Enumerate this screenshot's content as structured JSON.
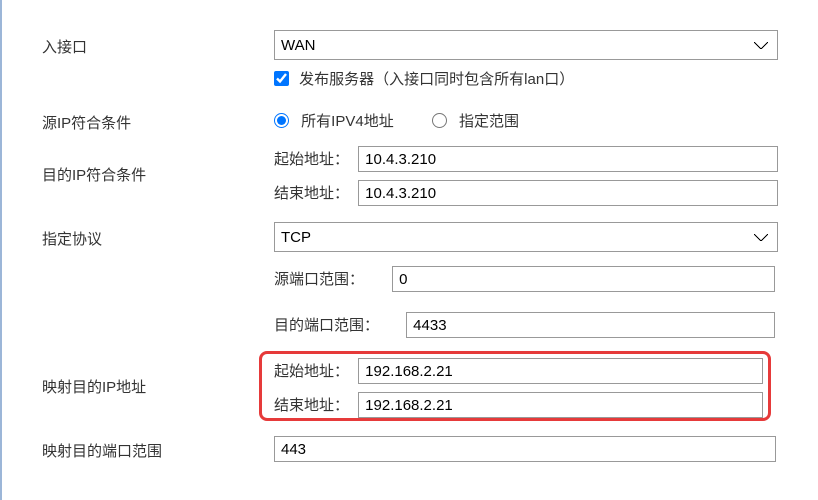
{
  "form": {
    "in_interface_label": "入接口",
    "in_interface_value": "WAN",
    "publish_server_label": "发布服务器（入接口同时包含所有lan口）",
    "src_ip_cond_label": "源IP符合条件",
    "radio_all_ipv4": "所有IPV4地址",
    "radio_range": "指定范围",
    "dest_ip_cond_label": "目的IP符合条件",
    "addr_start_label": "起始地址：",
    "addr_end_label": "结束地址：",
    "dest_start_value": "10.4.3.210",
    "dest_end_value": "10.4.3.210",
    "proto_label": "指定协议",
    "proto_value": "TCP",
    "src_port_range_label": "源端口范围：",
    "src_port_range_value": "0",
    "dest_port_range_label": "目的端口范围：",
    "dest_port_range_value": "4433",
    "map_dest_ip_label": "映射目的IP地址",
    "map_dest_start_value": "192.168.2.21",
    "map_dest_end_value": "192.168.2.21",
    "map_dest_port_label": "映射目的端口范围",
    "map_dest_port_value": "443"
  }
}
